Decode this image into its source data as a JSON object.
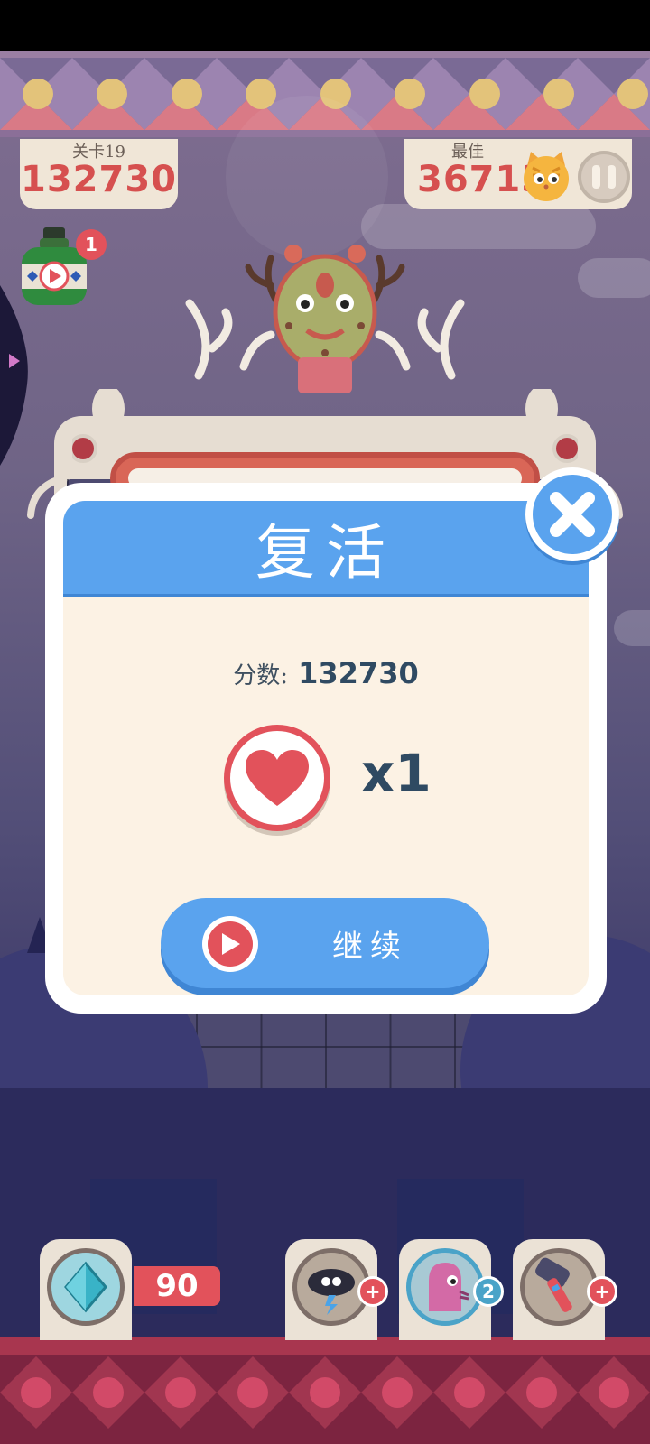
{
  "level_card": {
    "label": "关卡19",
    "score": "132730"
  },
  "best_card": {
    "label": "最佳",
    "score": "36713"
  },
  "bottle_badge": "1",
  "revive_modal": {
    "title": "复活",
    "score_label": "分数:",
    "score_value": "132730",
    "heart_count": "x1",
    "continue_label": "继续"
  },
  "toolbar": {
    "gem_count": "90",
    "ghost_badge": "2"
  },
  "colors": {
    "accent_blue": "#5aa3ee",
    "heart_red": "#e2525b",
    "score_red": "#d6504f",
    "modal_bg": "#fcf2e4"
  },
  "icons": [
    "close-icon",
    "heart-icon",
    "play-icon",
    "pause-icon",
    "cat-avatar-icon",
    "gem-icon",
    "storm-cloud-icon",
    "ghost-icon",
    "hammer-icon",
    "plus-icon",
    "potion-bottle-icon"
  ]
}
